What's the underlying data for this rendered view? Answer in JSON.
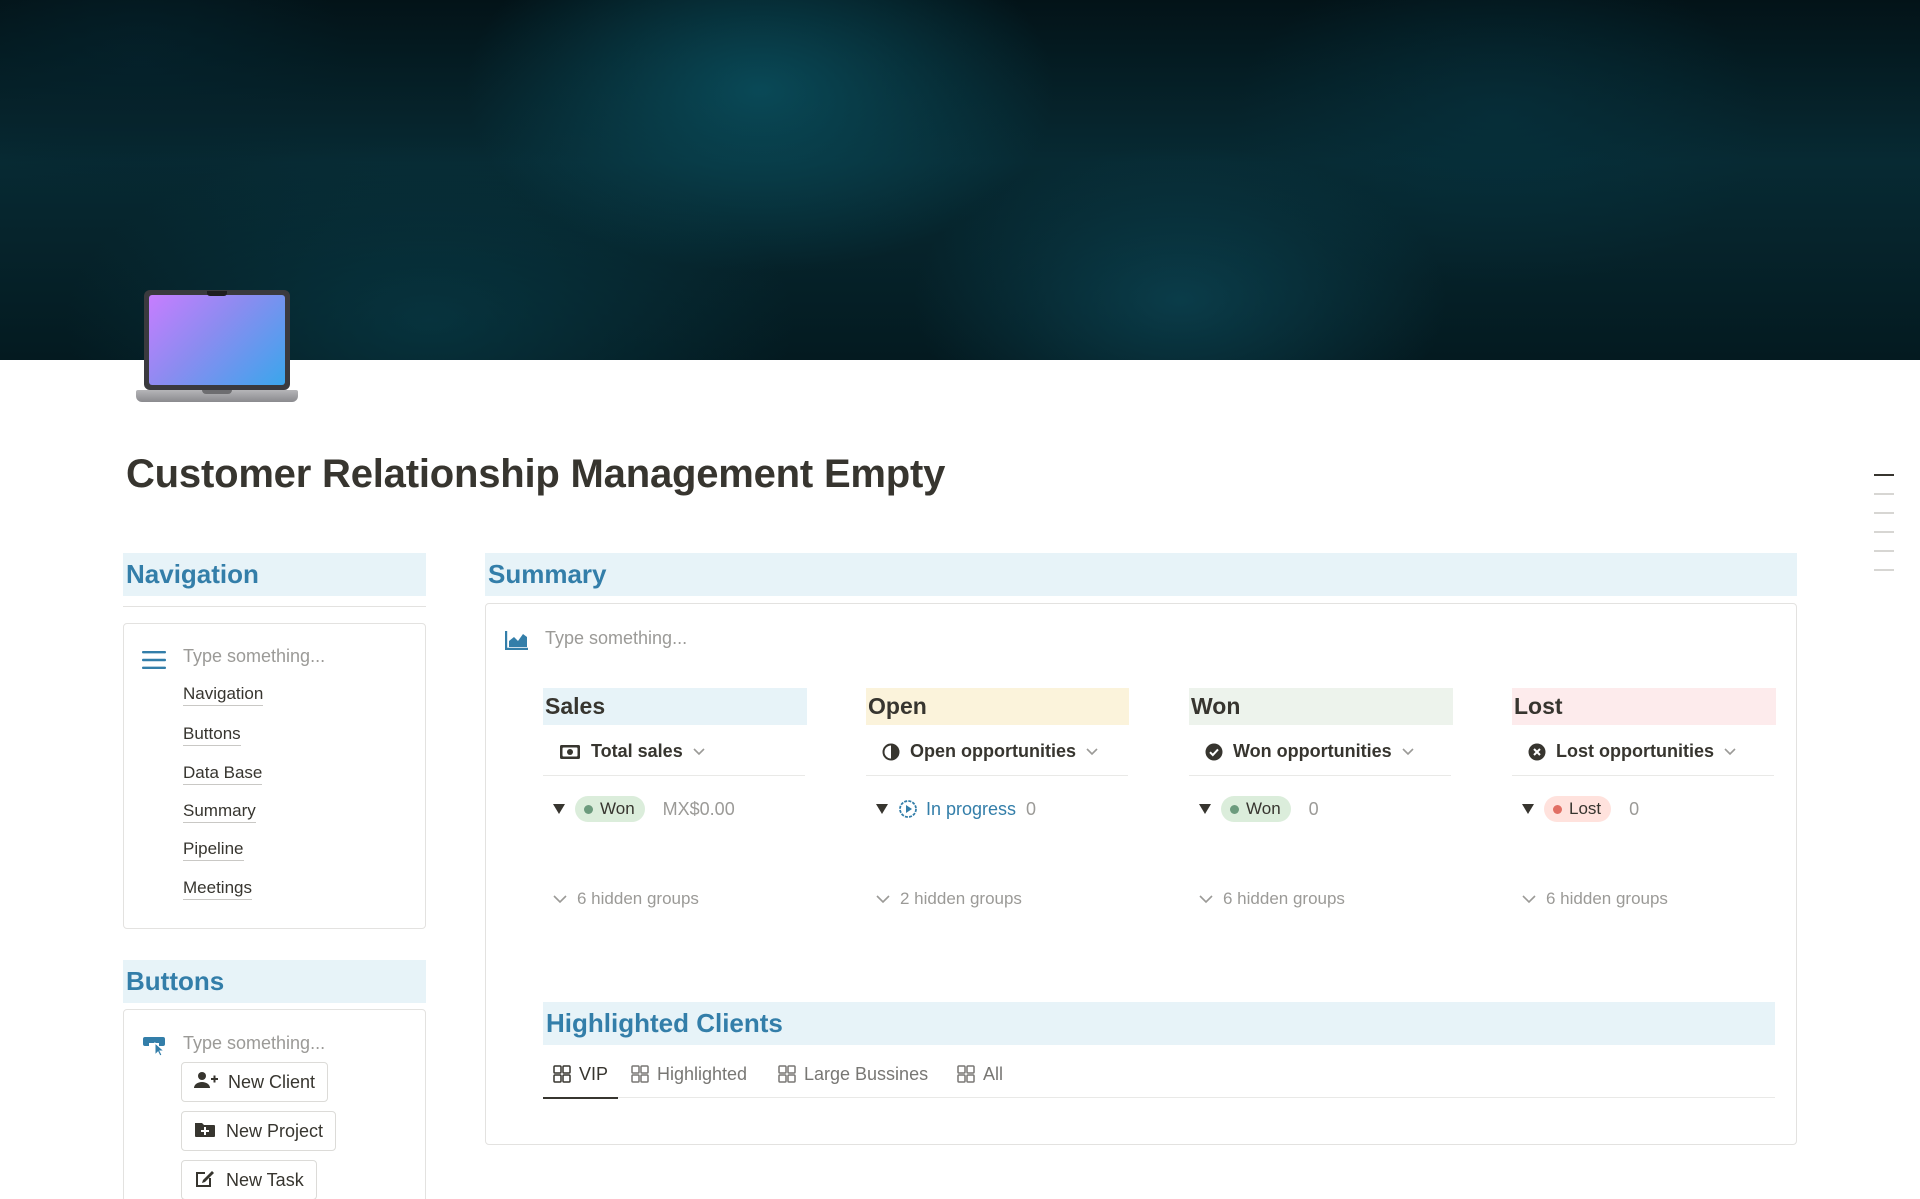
{
  "page": {
    "title": "Customer Relationship Management Empty",
    "icon": "laptop-icon"
  },
  "navigation": {
    "heading": "Navigation",
    "placeholder": "Type something...",
    "icon": "menu-icon",
    "links": [
      "Navigation",
      "Buttons",
      "Data Base",
      "Summary",
      "Pipeline",
      "Meetings"
    ]
  },
  "buttons": {
    "heading": "Buttons",
    "placeholder": "Type something...",
    "icon": "hand-pointer-icon",
    "items": [
      {
        "label": "New Client",
        "icon": "add-user-icon"
      },
      {
        "label": "New Project",
        "icon": "folder-plus-icon"
      },
      {
        "label": "New Task",
        "icon": "edit-icon"
      }
    ]
  },
  "summary": {
    "heading": "Summary",
    "placeholder": "Type something...",
    "icon": "area-chart-icon",
    "columns": [
      {
        "title": "Sales",
        "header_color": "#e7f3f8",
        "view": "Total sales",
        "view_icon": "money-icon",
        "group": "Won",
        "group_kind": "tag",
        "tag_bg": "#dbeddb",
        "dot": "#6c9b7d",
        "value": "MX$0.00",
        "hidden": "6 hidden groups"
      },
      {
        "title": "Open",
        "header_color": "#fbf3db",
        "view": "Open opportunities",
        "view_icon": "half-circle-icon",
        "group": "In progress",
        "group_kind": "status",
        "value": "0",
        "hidden": "2 hidden groups"
      },
      {
        "title": "Won",
        "header_color": "#edf3ec",
        "view": "Won opportunities",
        "view_icon": "check-circle-icon",
        "group": "Won",
        "group_kind": "tag",
        "tag_bg": "#dbeddb",
        "dot": "#6c9b7d",
        "value": "0",
        "hidden": "6 hidden groups"
      },
      {
        "title": "Lost",
        "header_color": "#fdebec",
        "view": "Lost opportunities",
        "view_icon": "x-circle-icon",
        "group": "Lost",
        "group_kind": "tag",
        "tag_bg": "#ffe2dd",
        "dot": "#e16f64",
        "value": "0",
        "hidden": "6 hidden groups"
      }
    ]
  },
  "highlighted_clients": {
    "heading": "Highlighted Clients",
    "tabs": [
      "VIP",
      "Highlighted",
      "Large Bussines",
      "All"
    ],
    "active_tab": "VIP"
  },
  "colors": {
    "accent_blue": "#337ea9",
    "heading_bg": "#e7f3f8",
    "text": "#37352f",
    "muted": "#9b9a97"
  }
}
